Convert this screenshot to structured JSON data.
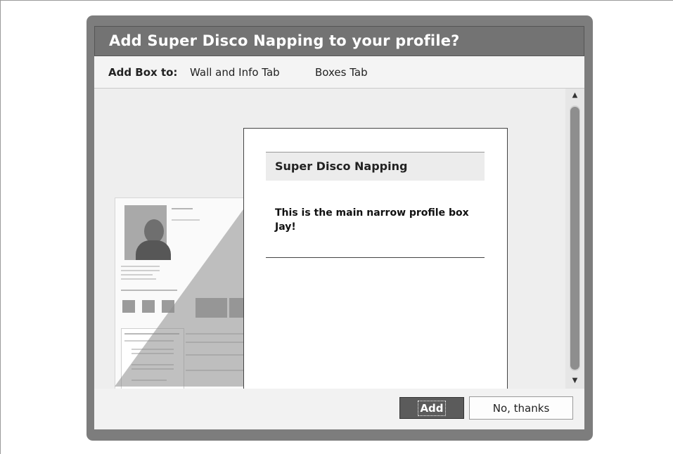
{
  "dialog": {
    "title": "Add Super Disco Napping to your profile?"
  },
  "tabs": {
    "label": "Add Box to:",
    "items": [
      "Wall and Info Tab",
      "Boxes Tab"
    ]
  },
  "preview": {
    "box_title": "Super Disco Napping",
    "box_body": "This is the main narrow profile box Jay!"
  },
  "buttons": {
    "add": "Add",
    "cancel": "No, thanks"
  },
  "icons": {
    "scroll_up": "triangle-up-icon",
    "scroll_down": "triangle-down-icon"
  }
}
